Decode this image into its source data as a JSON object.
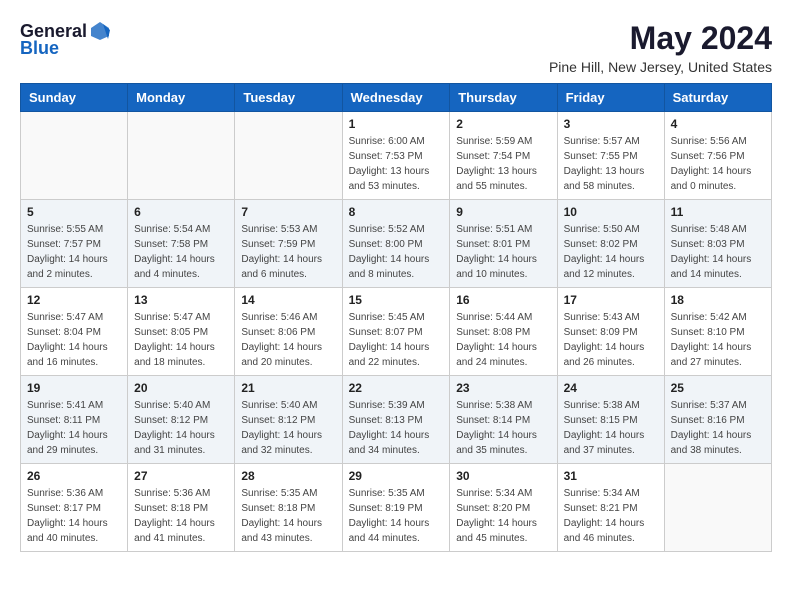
{
  "logo": {
    "general": "General",
    "blue": "Blue"
  },
  "title": "May 2024",
  "location": "Pine Hill, New Jersey, United States",
  "headers": [
    "Sunday",
    "Monday",
    "Tuesday",
    "Wednesday",
    "Thursday",
    "Friday",
    "Saturday"
  ],
  "weeks": [
    [
      {
        "day": "",
        "sunrise": "",
        "sunset": "",
        "daylight": ""
      },
      {
        "day": "",
        "sunrise": "",
        "sunset": "",
        "daylight": ""
      },
      {
        "day": "",
        "sunrise": "",
        "sunset": "",
        "daylight": ""
      },
      {
        "day": "1",
        "sunrise": "Sunrise: 6:00 AM",
        "sunset": "Sunset: 7:53 PM",
        "daylight": "Daylight: 13 hours and 53 minutes."
      },
      {
        "day": "2",
        "sunrise": "Sunrise: 5:59 AM",
        "sunset": "Sunset: 7:54 PM",
        "daylight": "Daylight: 13 hours and 55 minutes."
      },
      {
        "day": "3",
        "sunrise": "Sunrise: 5:57 AM",
        "sunset": "Sunset: 7:55 PM",
        "daylight": "Daylight: 13 hours and 58 minutes."
      },
      {
        "day": "4",
        "sunrise": "Sunrise: 5:56 AM",
        "sunset": "Sunset: 7:56 PM",
        "daylight": "Daylight: 14 hours and 0 minutes."
      }
    ],
    [
      {
        "day": "5",
        "sunrise": "Sunrise: 5:55 AM",
        "sunset": "Sunset: 7:57 PM",
        "daylight": "Daylight: 14 hours and 2 minutes."
      },
      {
        "day": "6",
        "sunrise": "Sunrise: 5:54 AM",
        "sunset": "Sunset: 7:58 PM",
        "daylight": "Daylight: 14 hours and 4 minutes."
      },
      {
        "day": "7",
        "sunrise": "Sunrise: 5:53 AM",
        "sunset": "Sunset: 7:59 PM",
        "daylight": "Daylight: 14 hours and 6 minutes."
      },
      {
        "day": "8",
        "sunrise": "Sunrise: 5:52 AM",
        "sunset": "Sunset: 8:00 PM",
        "daylight": "Daylight: 14 hours and 8 minutes."
      },
      {
        "day": "9",
        "sunrise": "Sunrise: 5:51 AM",
        "sunset": "Sunset: 8:01 PM",
        "daylight": "Daylight: 14 hours and 10 minutes."
      },
      {
        "day": "10",
        "sunrise": "Sunrise: 5:50 AM",
        "sunset": "Sunset: 8:02 PM",
        "daylight": "Daylight: 14 hours and 12 minutes."
      },
      {
        "day": "11",
        "sunrise": "Sunrise: 5:48 AM",
        "sunset": "Sunset: 8:03 PM",
        "daylight": "Daylight: 14 hours and 14 minutes."
      }
    ],
    [
      {
        "day": "12",
        "sunrise": "Sunrise: 5:47 AM",
        "sunset": "Sunset: 8:04 PM",
        "daylight": "Daylight: 14 hours and 16 minutes."
      },
      {
        "day": "13",
        "sunrise": "Sunrise: 5:47 AM",
        "sunset": "Sunset: 8:05 PM",
        "daylight": "Daylight: 14 hours and 18 minutes."
      },
      {
        "day": "14",
        "sunrise": "Sunrise: 5:46 AM",
        "sunset": "Sunset: 8:06 PM",
        "daylight": "Daylight: 14 hours and 20 minutes."
      },
      {
        "day": "15",
        "sunrise": "Sunrise: 5:45 AM",
        "sunset": "Sunset: 8:07 PM",
        "daylight": "Daylight: 14 hours and 22 minutes."
      },
      {
        "day": "16",
        "sunrise": "Sunrise: 5:44 AM",
        "sunset": "Sunset: 8:08 PM",
        "daylight": "Daylight: 14 hours and 24 minutes."
      },
      {
        "day": "17",
        "sunrise": "Sunrise: 5:43 AM",
        "sunset": "Sunset: 8:09 PM",
        "daylight": "Daylight: 14 hours and 26 minutes."
      },
      {
        "day": "18",
        "sunrise": "Sunrise: 5:42 AM",
        "sunset": "Sunset: 8:10 PM",
        "daylight": "Daylight: 14 hours and 27 minutes."
      }
    ],
    [
      {
        "day": "19",
        "sunrise": "Sunrise: 5:41 AM",
        "sunset": "Sunset: 8:11 PM",
        "daylight": "Daylight: 14 hours and 29 minutes."
      },
      {
        "day": "20",
        "sunrise": "Sunrise: 5:40 AM",
        "sunset": "Sunset: 8:12 PM",
        "daylight": "Daylight: 14 hours and 31 minutes."
      },
      {
        "day": "21",
        "sunrise": "Sunrise: 5:40 AM",
        "sunset": "Sunset: 8:12 PM",
        "daylight": "Daylight: 14 hours and 32 minutes."
      },
      {
        "day": "22",
        "sunrise": "Sunrise: 5:39 AM",
        "sunset": "Sunset: 8:13 PM",
        "daylight": "Daylight: 14 hours and 34 minutes."
      },
      {
        "day": "23",
        "sunrise": "Sunrise: 5:38 AM",
        "sunset": "Sunset: 8:14 PM",
        "daylight": "Daylight: 14 hours and 35 minutes."
      },
      {
        "day": "24",
        "sunrise": "Sunrise: 5:38 AM",
        "sunset": "Sunset: 8:15 PM",
        "daylight": "Daylight: 14 hours and 37 minutes."
      },
      {
        "day": "25",
        "sunrise": "Sunrise: 5:37 AM",
        "sunset": "Sunset: 8:16 PM",
        "daylight": "Daylight: 14 hours and 38 minutes."
      }
    ],
    [
      {
        "day": "26",
        "sunrise": "Sunrise: 5:36 AM",
        "sunset": "Sunset: 8:17 PM",
        "daylight": "Daylight: 14 hours and 40 minutes."
      },
      {
        "day": "27",
        "sunrise": "Sunrise: 5:36 AM",
        "sunset": "Sunset: 8:18 PM",
        "daylight": "Daylight: 14 hours and 41 minutes."
      },
      {
        "day": "28",
        "sunrise": "Sunrise: 5:35 AM",
        "sunset": "Sunset: 8:18 PM",
        "daylight": "Daylight: 14 hours and 43 minutes."
      },
      {
        "day": "29",
        "sunrise": "Sunrise: 5:35 AM",
        "sunset": "Sunset: 8:19 PM",
        "daylight": "Daylight: 14 hours and 44 minutes."
      },
      {
        "day": "30",
        "sunrise": "Sunrise: 5:34 AM",
        "sunset": "Sunset: 8:20 PM",
        "daylight": "Daylight: 14 hours and 45 minutes."
      },
      {
        "day": "31",
        "sunrise": "Sunrise: 5:34 AM",
        "sunset": "Sunset: 8:21 PM",
        "daylight": "Daylight: 14 hours and 46 minutes."
      },
      {
        "day": "",
        "sunrise": "",
        "sunset": "",
        "daylight": ""
      }
    ]
  ]
}
